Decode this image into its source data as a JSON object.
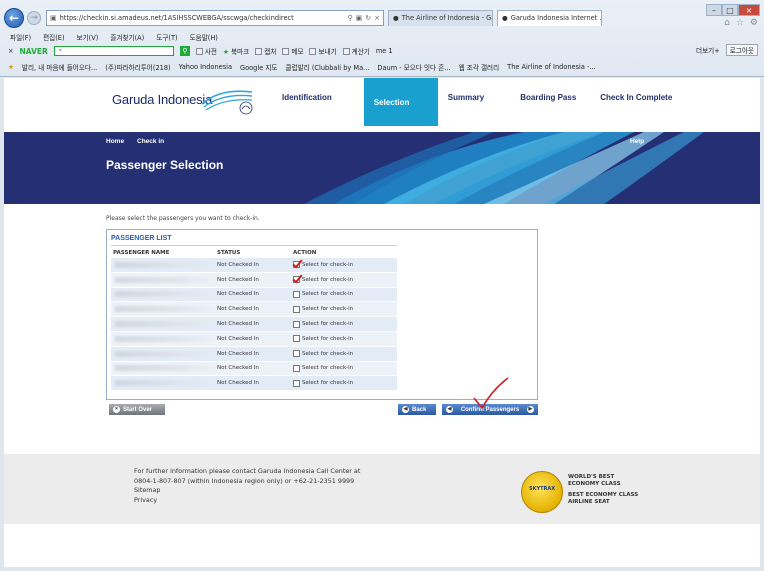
{
  "browser": {
    "address_url": "https://checkin.si.amadeus.net/1ASIHSSCWEBGA/sscwga/checkindirect",
    "tabs": [
      {
        "label": "The Airline of Indonesia - Gar..."
      },
      {
        "label": "Garuda Indonesia Internet ..."
      }
    ],
    "menu": [
      "파일(F)",
      "편집(E)",
      "보기(V)",
      "즐겨찾기(A)",
      "도구(T)",
      "도움말(H)"
    ],
    "toolbar": {
      "brand": "NAVER",
      "items": [
        "사전",
        "북마크",
        "캡처",
        "메모",
        "보내기",
        "계산기",
        "me 1"
      ],
      "right": [
        "더보기+",
        "로그아웃"
      ]
    },
    "favorites": [
      "발리, 내 마음에 들어오다...",
      "(주)따라하리투어(218)",
      "Yahoo Indonesia",
      "Google 지도",
      "클럽발리 (Clubbali by Ma...",
      "Daum - 모으다 잇다 흔...",
      "웹 조각 갤러리",
      "The Airline of Indonesia -..."
    ]
  },
  "header": {
    "logo_text": "Garuda Indonesia",
    "steps": [
      "Identification",
      "Selection",
      "Summary",
      "Boarding Pass",
      "Check In Complete"
    ],
    "active_step": "Selection"
  },
  "banner": {
    "nav_home": "Home",
    "nav_checkin": "Check in",
    "nav_help": "Help",
    "title": "Passenger Selection"
  },
  "instructions": "Please select the passengers you want to check-in.",
  "passenger_list": {
    "title": "PASSENGER LIST",
    "headers": {
      "name": "PASSENGER NAME",
      "status": "STATUS",
      "action": "ACTION"
    },
    "rows": [
      {
        "status": "Not Checked In",
        "action": "Select for check-in",
        "checked": true
      },
      {
        "status": "Not Checked In",
        "action": "Select for check-in",
        "checked": true
      },
      {
        "status": "Not Checked In",
        "action": "Select for check-in",
        "checked": false
      },
      {
        "status": "Not Checked In",
        "action": "Select for check-in",
        "checked": false
      },
      {
        "status": "Not Checked In",
        "action": "Select for check-in",
        "checked": false
      },
      {
        "status": "Not Checked In",
        "action": "Select for check-in",
        "checked": false
      },
      {
        "status": "Not Checked In",
        "action": "Select for check-in",
        "checked": false
      },
      {
        "status": "Not Checked In",
        "action": "Select for check-in",
        "checked": false
      },
      {
        "status": "Not Checked In",
        "action": "Select for check-in",
        "checked": false
      }
    ]
  },
  "buttons": {
    "start_over": "Start Over",
    "back": "Back",
    "confirm": "Confirm Passengers"
  },
  "footer": {
    "line1": "For further information please contact Garuda Indonesia Call Center at",
    "line2": "0804-1-807-807 (within Indonesia region only) or +62-21-2351 9999",
    "sitemap": "Sitemap",
    "privacy": "Privacy",
    "seal_text": "SKYTRAX",
    "award1_line1": "WORLD'S BEST",
    "award1_line2": "ECONOMY CLASS",
    "award2_line1": "BEST ECONOMY CLASS",
    "award2_line2": "AIRLINE SEAT"
  },
  "colors": {
    "brand_navy": "#252f74",
    "active_step": "#1aa0cf",
    "button_blue": "#2c5aa2"
  }
}
